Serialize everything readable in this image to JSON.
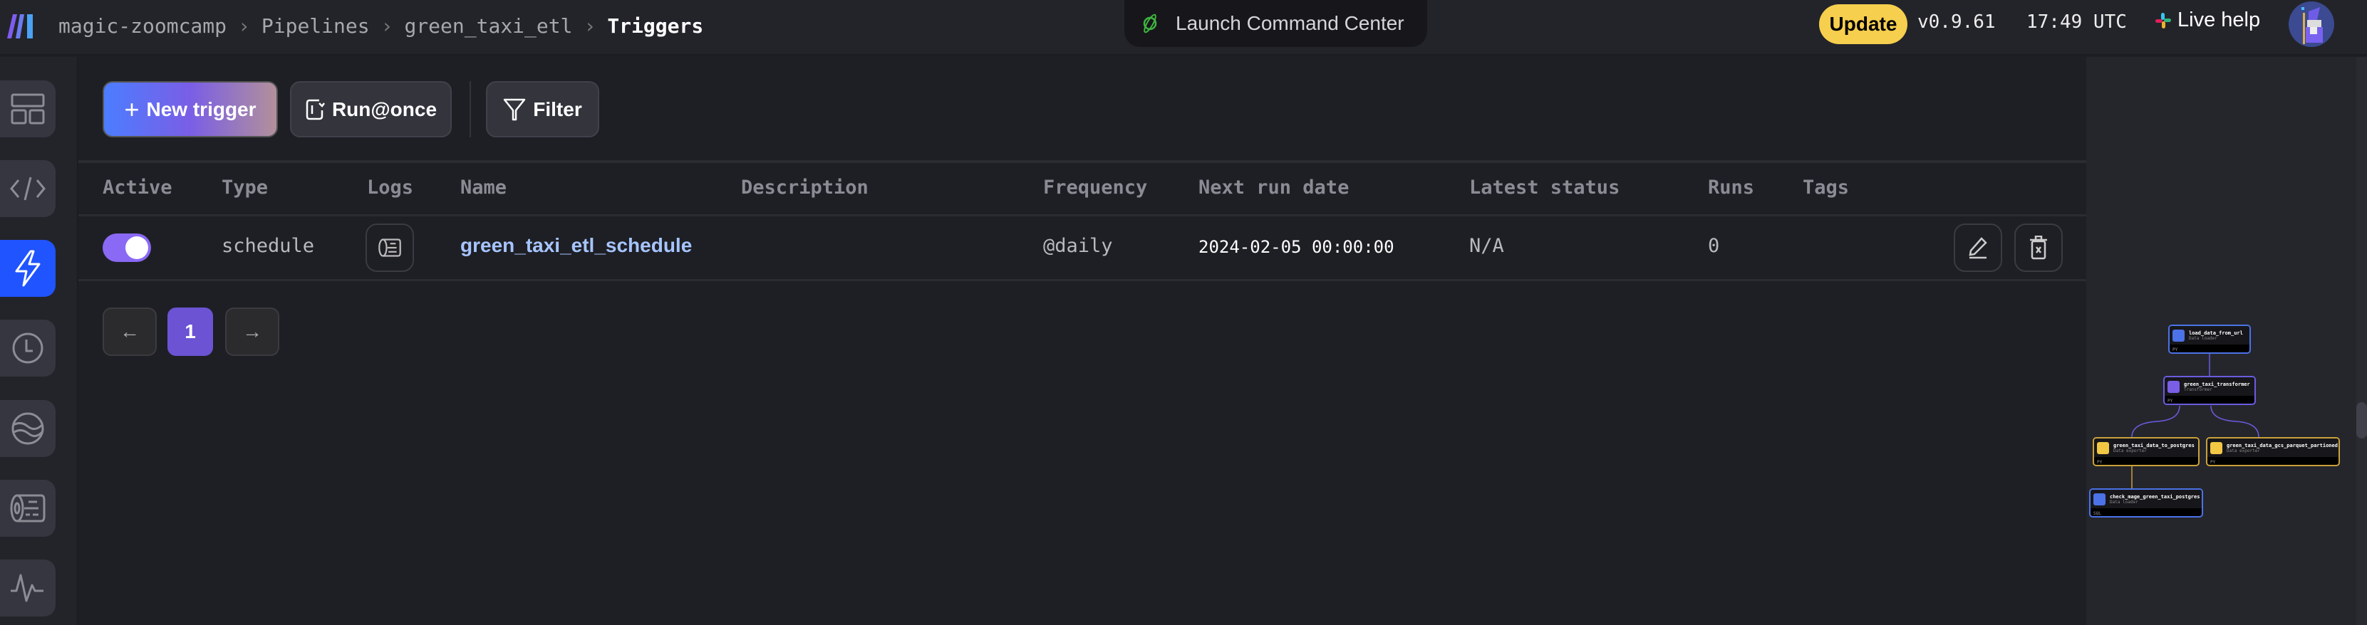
{
  "header": {
    "breadcrumbs": [
      "magic-zoomcamp",
      "Pipelines",
      "green_taxi_etl"
    ],
    "current_page": "Triggers",
    "command_center": "Launch Command Center",
    "update": "Update",
    "version": "v0.9.61",
    "time": "17:49 UTC",
    "live_help": "Live help"
  },
  "sidebar": {
    "items": [
      "pipeline-overview",
      "edit-code",
      "triggers",
      "runs",
      "block-runs",
      "logs",
      "monitor"
    ],
    "active": "triggers"
  },
  "toolbar": {
    "new_trigger": "New trigger",
    "run_once": "Run@once",
    "filter": "Filter"
  },
  "table": {
    "columns": [
      "Active",
      "Type",
      "Logs",
      "Name",
      "Description",
      "Frequency",
      "Next run date",
      "Latest status",
      "Runs",
      "Tags"
    ],
    "rows": [
      {
        "active": true,
        "type": "schedule",
        "name": "green_taxi_etl_schedule",
        "description": "",
        "frequency": "@daily",
        "next_run": "2024-02-05 00:00:00",
        "status": "N/A",
        "runs": "0",
        "tags": ""
      }
    ]
  },
  "pagination": {
    "current": "1"
  },
  "graph": {
    "nodes": [
      {
        "name": "load_data_from_url",
        "kind": "Data loader",
        "lang": "PY"
      },
      {
        "name": "green_taxi_transformer",
        "kind": "Transformer",
        "lang": "PY"
      },
      {
        "name": "green_taxi_data_to_postgres",
        "kind": "Data exporter",
        "lang": "PY"
      },
      {
        "name": "green_taxi_data_gcs_parquet_partioned",
        "kind": "Data exporter",
        "lang": "PY"
      },
      {
        "name": "check_mage_green_taxi_postgres",
        "kind": "Data loader",
        "lang": "SQL"
      }
    ]
  },
  "colors": {
    "accent": "#2054ff",
    "toggle": "#8a69f5",
    "update": "#f7cf4e",
    "loader": "#4b72e6",
    "transformer": "#7a5ee6",
    "exporter": "#e6b43c",
    "name_link": "#a6c4ff"
  }
}
